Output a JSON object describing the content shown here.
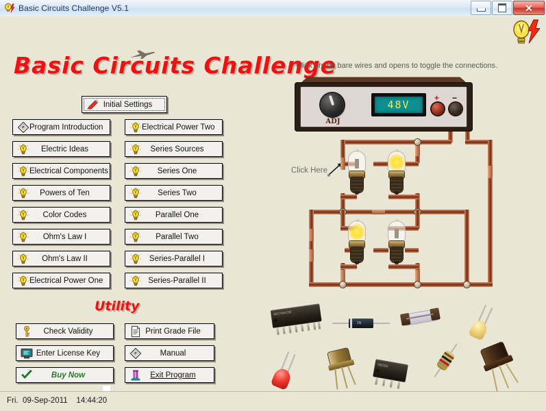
{
  "window": {
    "title": "Basic Circuits Challenge V5.1",
    "icon": "bulb-bolt-icon",
    "controls": {
      "minimize": "—",
      "maximize": "▢",
      "close": "✕"
    }
  },
  "header": {
    "headline": "Basic Circuits Challenge",
    "logo_icon": "bulb-bolt-icon",
    "plane_icon": "airplane-icon"
  },
  "top_button": {
    "label": "Initial Settings",
    "icon": "red-pen-icon",
    "focused": true
  },
  "menu": {
    "left_column": [
      {
        "label": "Program Introduction",
        "icon": "diamond-color-icon"
      },
      {
        "label": "Electric Ideas",
        "icon": "bulb-icon"
      },
      {
        "label": "Electrical Components",
        "icon": "bulb-icon"
      },
      {
        "label": "Powers of Ten",
        "icon": "bulb-icon"
      },
      {
        "label": "Color Codes",
        "icon": "bulb-icon"
      },
      {
        "label": "Ohm's Law I",
        "icon": "bulb-icon"
      },
      {
        "label": "Ohm's Law II",
        "icon": "bulb-icon"
      },
      {
        "label": "Electrical Power One",
        "icon": "bulb-icon"
      }
    ],
    "right_column": [
      {
        "label": "Electrical Power Two",
        "icon": "bulb-icon"
      },
      {
        "label": "Series Sources",
        "icon": "bulb-icon"
      },
      {
        "label": "Series One",
        "icon": "bulb-icon"
      },
      {
        "label": "Series Two",
        "icon": "bulb-icon"
      },
      {
        "label": "Parallel One",
        "icon": "bulb-icon"
      },
      {
        "label": "Parallel Two",
        "icon": "bulb-icon"
      },
      {
        "label": "Series-Parallel I",
        "icon": "bulb-icon"
      },
      {
        "label": "Series-Parallel II",
        "icon": "bulb-icon"
      }
    ]
  },
  "utility": {
    "heading": "Utility",
    "left_column": [
      {
        "label": "Check Validity",
        "icon": "key-icon"
      },
      {
        "label": "Enter License Key",
        "icon": "monitor-icon"
      },
      {
        "label": "Buy Now",
        "icon": "green-check-icon"
      }
    ],
    "right_column": [
      {
        "label": "Print Grade File",
        "icon": "document-icon"
      },
      {
        "label": "Manual",
        "icon": "diamond-color-icon"
      },
      {
        "label": "Exit Program",
        "icon": "exit-door-icon"
      }
    ]
  },
  "simulation": {
    "hint": "Click on the bare wires and opens to toggle the connections.",
    "click_here": "Click Here",
    "power_supply": {
      "display_value": "48V",
      "knob_label": "ADJ",
      "positive_terminal": "+",
      "negative_terminal": "−"
    },
    "bulbs": [
      {
        "position": "top-left",
        "lit": false
      },
      {
        "position": "top-right",
        "lit": true
      },
      {
        "position": "bottom-left",
        "lit": true
      },
      {
        "position": "bottom-right",
        "lit": false
      }
    ]
  },
  "components_image": {
    "alt": "electronic components photo collage",
    "items": [
      "dip-ic-16pin",
      "diode",
      "glass-fuse",
      "yellow-led",
      "red-led",
      "metal-can-transistor",
      "dip-ic-8pin",
      "resistor",
      "to-5-transistor"
    ]
  },
  "statusbar": {
    "datetime": "Fri.  09-Sep-2011    14:44:20"
  },
  "colors": {
    "background": "#e9e6d6",
    "headline_red": "#ee1111",
    "button_face": "#f2f1ef",
    "lcd_teal": "#0e8f91",
    "lcd_text": "#ffe84a",
    "buy_now_green": "#2a7a2a",
    "wire_copper": "#9e4b2c"
  }
}
